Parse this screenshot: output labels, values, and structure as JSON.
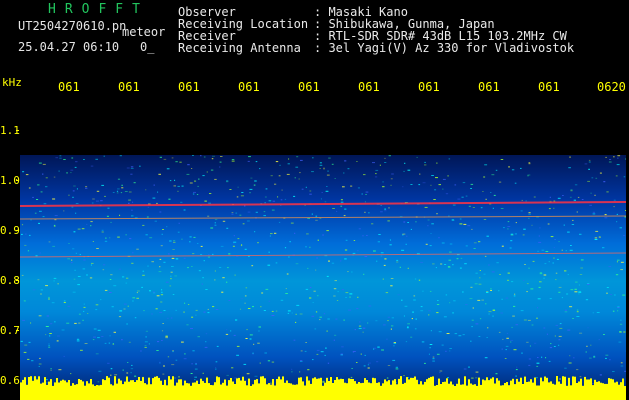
{
  "header": {
    "brand": "HROFFT",
    "filename_prefix": "UT2504270610.pn",
    "filename_suffix": "meteor",
    "datetime": "25.04.27 06:10",
    "datetime_suffix": "0_",
    "fields": [
      {
        "label": "Observer",
        "value": ": Masaki Kano"
      },
      {
        "label": "Receiving Location",
        "value": ": Shibukawa, Gunma, Japan"
      },
      {
        "label": "Receiver",
        "value": ": RTL-SDR SDR# 43dB L15 103.2MHz CW"
      },
      {
        "label": "Receiving Antenna",
        "value": ": 3el Yagi(V) Az 330 for Vladivostok"
      }
    ]
  },
  "axis": {
    "unit": "kHz",
    "time_ticks": [
      "061",
      "061",
      "061",
      "061",
      "061",
      "061",
      "061",
      "061",
      "061",
      "0620"
    ],
    "freq_labels": [
      "1.1",
      "1.0",
      "0.9",
      "0.8",
      "0.7",
      "0.6"
    ]
  },
  "colors": {
    "header_brand": "#22c55e",
    "tick_color": "#ffff00",
    "background": "#000000"
  }
}
